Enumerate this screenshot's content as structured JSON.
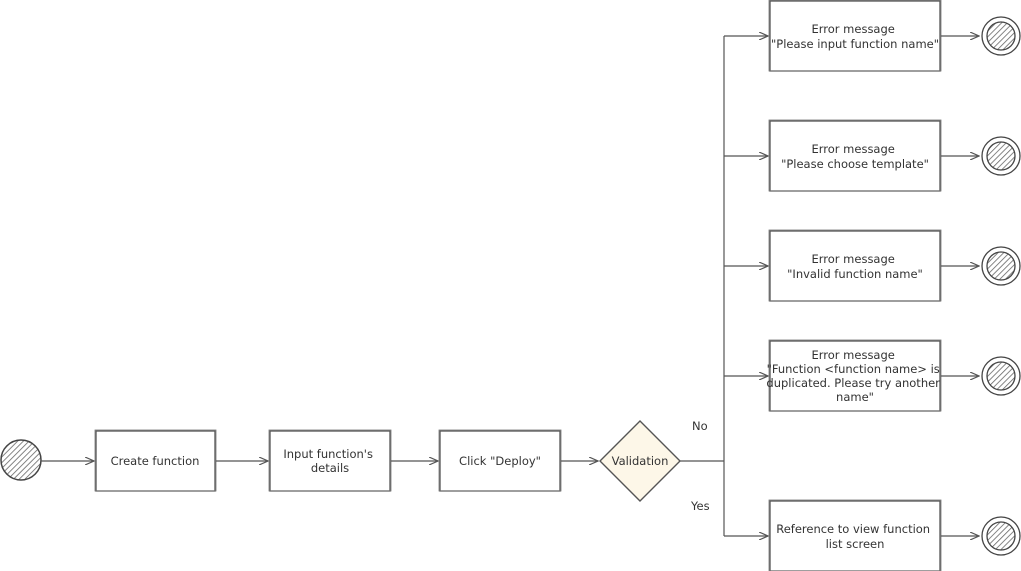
{
  "diagram": {
    "type": "activity-flowchart",
    "style": "hand-drawn",
    "colors": {
      "stroke": "#555555",
      "decision_fill": "#fdf7e8",
      "node_fill": "#ffffff"
    },
    "start": {
      "kind": "start-node"
    },
    "steps": [
      {
        "lines": [
          "Create function"
        ]
      },
      {
        "lines": [
          "Input function's",
          "details"
        ]
      },
      {
        "lines": [
          "Click \"Deploy\""
        ]
      }
    ],
    "decision": {
      "label": "Validation"
    },
    "branch_labels": {
      "no": "No",
      "yes": "Yes"
    },
    "outcomes": [
      {
        "lines": [
          "Error message",
          "\"Please input function name\""
        ]
      },
      {
        "lines": [
          "Error message",
          "\"Please choose template\""
        ]
      },
      {
        "lines": [
          "Error message",
          "\"Invalid function name\""
        ]
      },
      {
        "lines": [
          "Error message",
          "\"Function <function name> is",
          "duplicated. Please try another",
          "name\""
        ]
      },
      {
        "lines": [
          "Reference to view function",
          "list screen"
        ]
      }
    ]
  }
}
